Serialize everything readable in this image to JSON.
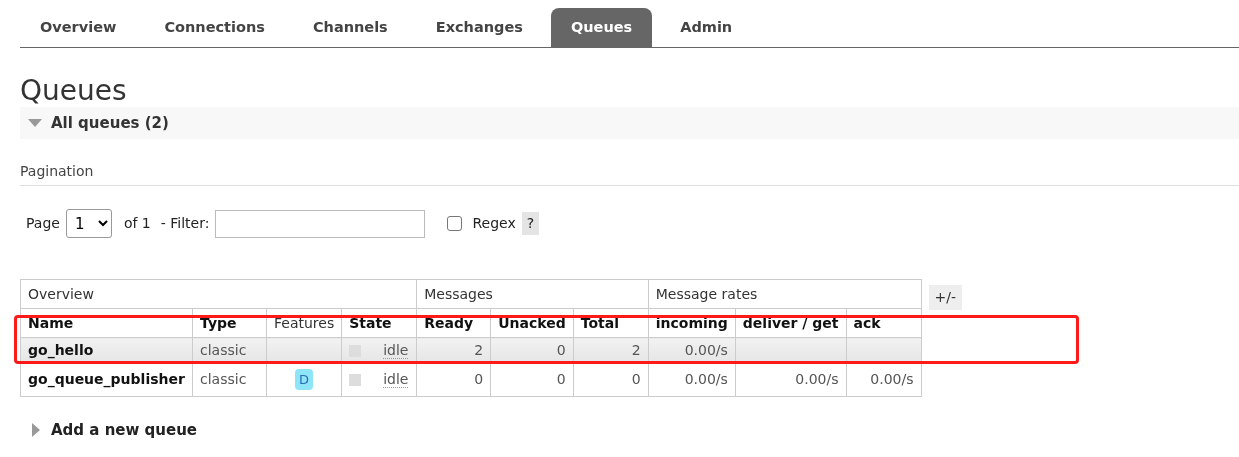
{
  "tabs": [
    {
      "label": "Overview",
      "selected": false
    },
    {
      "label": "Connections",
      "selected": false
    },
    {
      "label": "Channels",
      "selected": false
    },
    {
      "label": "Exchanges",
      "selected": false
    },
    {
      "label": "Queues",
      "selected": true
    },
    {
      "label": "Admin",
      "selected": false
    }
  ],
  "page_title": "Queues",
  "section": {
    "title": "All queues (2)",
    "expanded": true
  },
  "pagination": {
    "heading": "Pagination",
    "page_label": "Page",
    "page_value": "1",
    "of_label": "of 1",
    "filter_label": "- Filter:",
    "regex_label": "Regex",
    "regex_checked": false,
    "help": "?"
  },
  "table": {
    "groups": [
      {
        "label": "Overview",
        "columns": [
          "Name",
          "Type",
          "Features",
          "State"
        ]
      },
      {
        "label": "Messages",
        "columns": [
          "Ready",
          "Unacked",
          "Total"
        ]
      },
      {
        "label": "Message rates",
        "columns": [
          "incoming",
          "deliver / get",
          "ack"
        ]
      }
    ],
    "toggle": "+/-",
    "rows": [
      {
        "name": "go_hello",
        "type": "classic",
        "features": [],
        "state": "idle",
        "ready": "2",
        "unacked": "0",
        "total": "2",
        "incoming": "0.00/s",
        "deliver_get": "",
        "ack": "",
        "highlighted": true
      },
      {
        "name": "go_queue_publisher",
        "type": "classic",
        "features": [
          "D"
        ],
        "state": "idle",
        "ready": "0",
        "unacked": "0",
        "total": "0",
        "incoming": "0.00/s",
        "deliver_get": "0.00/s",
        "ack": "0.00/s",
        "highlighted": false
      }
    ]
  },
  "add_section": {
    "title": "Add a new queue",
    "expanded": false
  },
  "annotation": {
    "kind": "highlight",
    "color": "#ff1a1a"
  }
}
